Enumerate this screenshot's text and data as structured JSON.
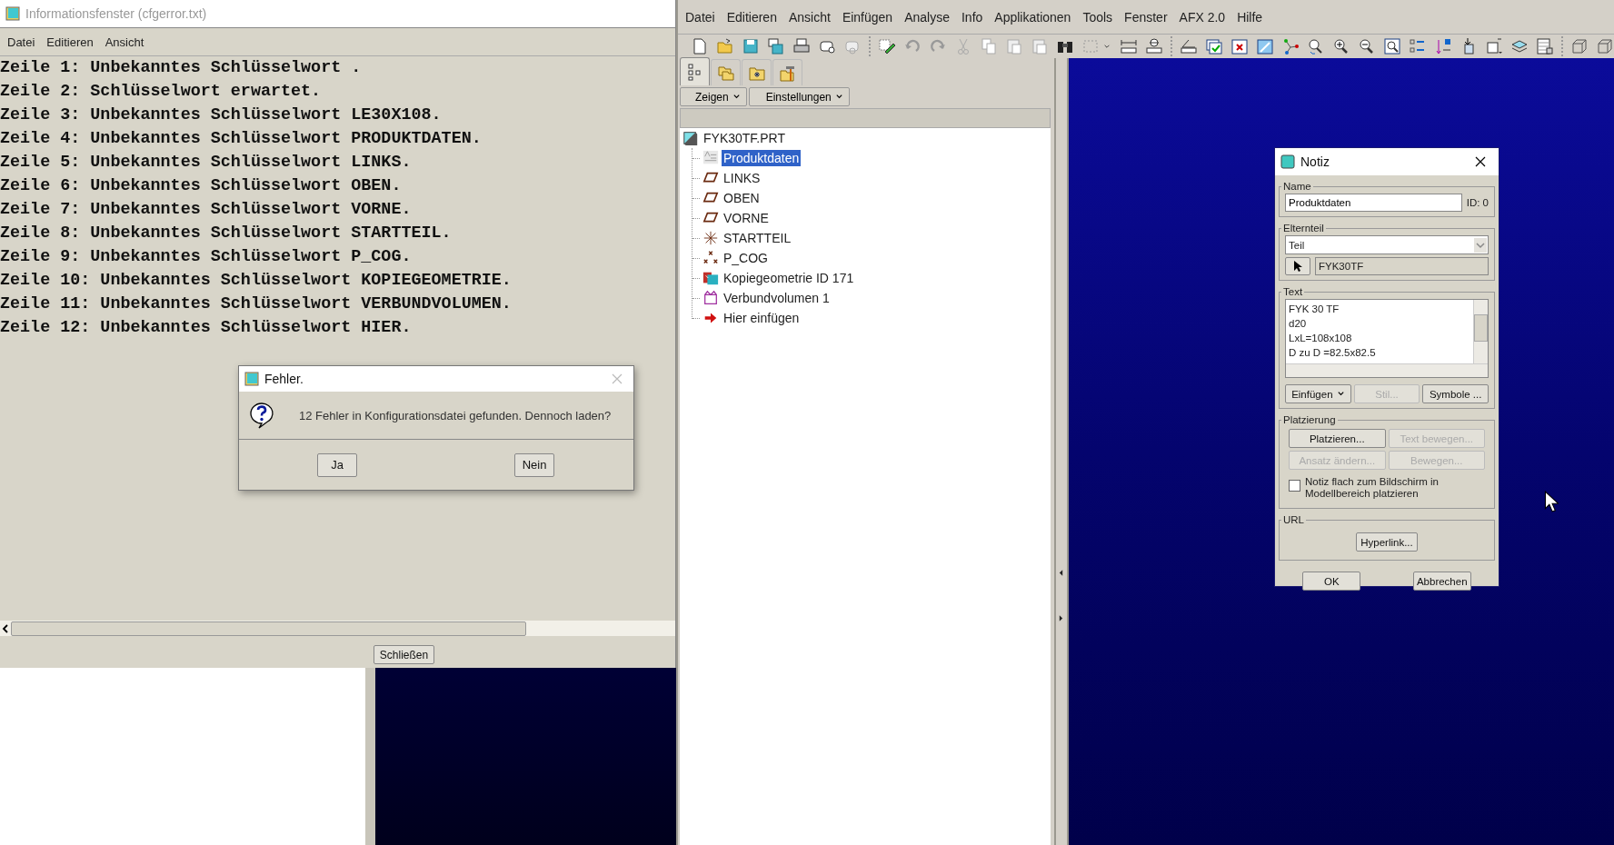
{
  "info_window": {
    "title": "Informationsfenster (cfgerror.txt)",
    "menu": [
      "Datei",
      "Editieren",
      "Ansicht"
    ],
    "lines": [
      "Zeile 1: Unbekanntes Schlüsselwort .",
      "Zeile 2: Schlüsselwort erwartet.",
      "Zeile 3: Unbekanntes Schlüsselwort LE30X108.",
      "Zeile 4: Unbekanntes Schlüsselwort PRODUKTDATEN.",
      "Zeile 5: Unbekanntes Schlüsselwort LINKS.",
      "Zeile 6: Unbekanntes Schlüsselwort OBEN.",
      "Zeile 7: Unbekanntes Schlüsselwort VORNE.",
      "Zeile 8: Unbekanntes Schlüsselwort STARTTEIL.",
      "Zeile 9: Unbekanntes Schlüsselwort P_COG.",
      "Zeile 10: Unbekanntes Schlüsselwort KOPIEGEOMETRIE.",
      "Zeile 11: Unbekanntes Schlüsselwort VERBUNDVOLUMEN.",
      "Zeile 12: Unbekanntes Schlüsselwort HIER."
    ],
    "close_button": "Schließen"
  },
  "error_dialog": {
    "title": "Fehler.",
    "message": "12 Fehler in Konfigurationsdatei gefunden. Dennoch laden?",
    "buttons": [
      "Ja",
      "Nein"
    ]
  },
  "main_window": {
    "menu": [
      "Datei",
      "Editieren",
      "Ansicht",
      "Einfügen",
      "Analyse",
      "Info",
      "Applikationen",
      "Tools",
      "Fenster",
      "AFX 2.0",
      "Hilfe"
    ],
    "tabs": [
      {
        "kind": "tree",
        "selected": true
      },
      {
        "kind": "folders",
        "selected": false
      },
      {
        "kind": "folder-star",
        "selected": false
      },
      {
        "kind": "folder-tools",
        "selected": false
      }
    ],
    "panel_buttons": [
      "Zeigen",
      "Einstellungen"
    ],
    "tree": {
      "label": "FYK30TF.PRT",
      "children": [
        {
          "label": "Produktdaten",
          "kind": "note",
          "selected": true
        },
        {
          "label": "LINKS",
          "kind": "plane",
          "selected": false
        },
        {
          "label": "OBEN",
          "kind": "plane",
          "selected": false
        },
        {
          "label": "VORNE",
          "kind": "plane",
          "selected": false
        },
        {
          "label": "STARTTEIL",
          "kind": "csys",
          "selected": false
        },
        {
          "label": "P_COG",
          "kind": "points",
          "selected": false
        },
        {
          "label": "Kopiegeometrie ID 171",
          "kind": "copy",
          "selected": false
        },
        {
          "label": "Verbundvolumen 1",
          "kind": "merge",
          "selected": false
        },
        {
          "label": "Hier einfügen",
          "kind": "insert",
          "selected": false
        }
      ]
    }
  },
  "note_dialog": {
    "title": "Notiz",
    "name_group": "Name",
    "name_value": "Produktdaten",
    "id": "ID: 0",
    "parent_group": "Elternteil",
    "parent_type": "Teil",
    "parent_ref": "FYK30TF",
    "text_group": "Text",
    "text_lines": [
      "FYK 30 TF",
      "d20",
      "LxL=108x108",
      "D zu D =82.5x82.5"
    ],
    "text_buttons": [
      {
        "label": "Einfügen",
        "kind": "menu",
        "disabled": false
      },
      {
        "label": "Stil...",
        "kind": "plain",
        "disabled": true
      },
      {
        "label": "Symbole ...",
        "kind": "plain",
        "disabled": false
      }
    ],
    "placement_group": "Platzierung",
    "placement_buttons": [
      {
        "label": "Platzieren...",
        "disabled": false
      },
      {
        "label": "Text bewegen...",
        "disabled": true
      },
      {
        "label": "Ansatz ändern...",
        "disabled": true
      },
      {
        "label": "Bewegen...",
        "disabled": true
      }
    ],
    "flat_checkbox": {
      "label": "Notiz flach zum Bildschirm in Modellbereich platzieren",
      "checked": false
    },
    "url_group": "URL",
    "hyperlink_button": "Hyperlink...",
    "ok_button": "OK",
    "cancel_button": "Abbrechen"
  }
}
